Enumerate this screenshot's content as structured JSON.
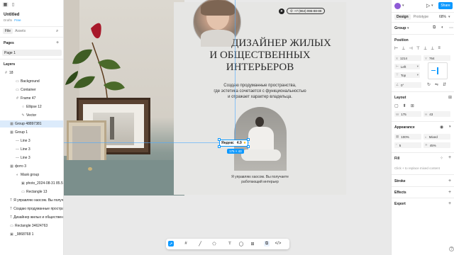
{
  "left": {
    "file_name": "Untitled",
    "drafts": "Drafts",
    "plan": "Free",
    "tab_file": "File",
    "tab_assets": "Assets",
    "pages_title": "Pages",
    "page1": "Page 1",
    "layers_title": "Layers",
    "layers": [
      {
        "label": "18",
        "indent": 0,
        "icon": "#"
      },
      {
        "label": "Background",
        "indent": 2,
        "icon": "▭"
      },
      {
        "label": "Container",
        "indent": 2,
        "icon": "▭"
      },
      {
        "label": "Frame 47",
        "indent": 2,
        "icon": "#"
      },
      {
        "label": "Ellipse 12",
        "indent": 3,
        "icon": "○"
      },
      {
        "label": "Vector",
        "indent": 3,
        "icon": "✎"
      },
      {
        "label": "Group 48897381",
        "indent": 1,
        "icon": "▦",
        "selected": true
      },
      {
        "label": "Group 1",
        "indent": 1,
        "icon": "▦"
      },
      {
        "label": "Line 3",
        "indent": 2,
        "icon": "—"
      },
      {
        "label": "Line 3",
        "indent": 2,
        "icon": "—"
      },
      {
        "label": "Line 3",
        "indent": 2,
        "icon": "—"
      },
      {
        "label": "фото 3",
        "indent": 1,
        "icon": "▦"
      },
      {
        "label": "Mask group",
        "indent": 2,
        "icon": "◐"
      },
      {
        "label": "photo_2024-08-31 85.5...",
        "indent": 3,
        "icon": "▣"
      },
      {
        "label": "Rectangle 13",
        "indent": 3,
        "icon": "▭"
      },
      {
        "label": "Я управляю хаосом. Вы получаете...",
        "indent": 1,
        "icon": "T"
      },
      {
        "label": "Создаю продуманные простран...",
        "indent": 1,
        "icon": "T"
      },
      {
        "label": "Дизайнер жилых и общественн...",
        "indent": 1,
        "icon": "T"
      },
      {
        "label": "Rectangle 34624763",
        "indent": 1,
        "icon": "▭"
      },
      {
        "label": "_9868768 1",
        "indent": 1,
        "icon": "▣"
      }
    ]
  },
  "canvas": {
    "phone": "+7 (964) 996-88-88",
    "title_line1": "ДИЗАЙНЕР ЖИЛЫХ",
    "title_line2": "И ОБЩЕСТВЕННЫХ",
    "title_line3": "ИНТЕРЬЕРОВ",
    "subtitle_line1": "Создаю продуманные пространства,",
    "subtitle_line2": "где эстетика сочетается с функциональностью",
    "subtitle_line3": "и отражает характер владельца.",
    "badge_brand": "Яндекс",
    "badge_rating": "4.9",
    "size_tag": "175 × 43",
    "caption_line1": "Я управляю хаосом. Вы получаете",
    "caption_line2": "работающий интерьер"
  },
  "toolbar": {
    "tools": [
      "move",
      "frame",
      "pen",
      "shape",
      "text",
      "comment",
      "actions",
      "dev"
    ]
  },
  "right": {
    "tab_design": "Design",
    "tab_prototype": "Prototype",
    "zoom": "68%",
    "share": "Share",
    "group_label": "Group",
    "position_title": "Position",
    "x": "1214",
    "y": "764",
    "h_constraint": "Left",
    "v_constraint": "Top",
    "rotation": "0°",
    "layout_title": "Layout",
    "w": "175",
    "h": "43",
    "appearance_title": "Appearance",
    "opacity": "100%",
    "blend": "Mixed",
    "corner": "5",
    "corner2": "45%",
    "fill_title": "Fill",
    "fill_hint": "Click + to replace mixed content",
    "stroke_title": "Stroke",
    "effects_title": "Effects",
    "export_title": "Export"
  },
  "colors": {
    "accent": "#0d99ff",
    "selection": "#dcebfb",
    "card_bg": "#e6e6e4"
  }
}
